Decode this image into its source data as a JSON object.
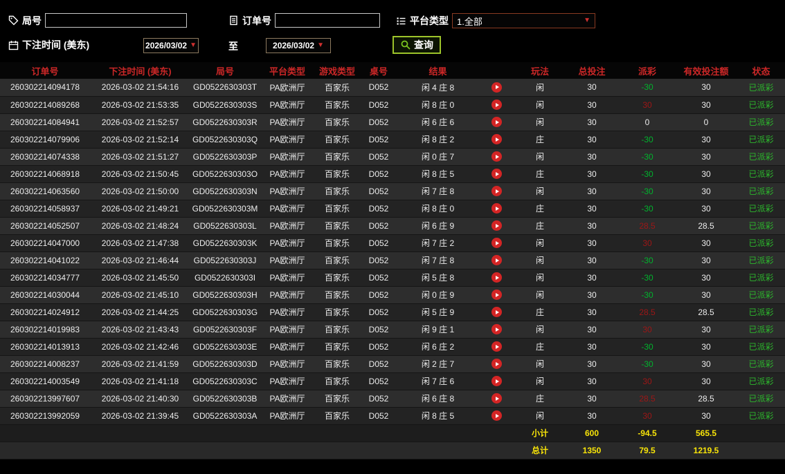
{
  "colors": {
    "header_text": "#cb2727",
    "payout_negative": "#00b32d",
    "payout_positive": "#9e1616",
    "status_paid": "#2db82d",
    "footer_text": "#f8e408",
    "play_icon": "#d42525",
    "query_border": "#9dc42a",
    "arrow_red": "#d03030"
  },
  "filters": {
    "game_no": {
      "label": "局号",
      "value": ""
    },
    "order_no": {
      "label": "订单号",
      "value": ""
    },
    "platform_type": {
      "label": "平台类型",
      "value": "1.全部"
    },
    "bet_time": {
      "label": "下注时间 (美东)",
      "from": "2026/03/02",
      "to_separator": "至",
      "to": "2026/03/02"
    },
    "query_label": "查询"
  },
  "table": {
    "headers": [
      "订单号",
      "下注时间 (美东)",
      "局号",
      "平台类型",
      "游戏类型",
      "桌号",
      "结果",
      "玩法",
      "总投注",
      "派彩",
      "有效投注额",
      "状态"
    ],
    "rows": [
      {
        "order_no": "260302214094178",
        "bet_time": "2026-03-02 21:54:16",
        "game_no": "GD0522630303T",
        "platform": "PA欧洲厅",
        "game_type": "百家乐",
        "table_no": "D052",
        "result": "闲 4 庄 8",
        "bet_side": "闲",
        "total_bet": "30",
        "payout": "-30",
        "valid_bet": "30",
        "status": "已派彩"
      },
      {
        "order_no": "260302214089268",
        "bet_time": "2026-03-02 21:53:35",
        "game_no": "GD0522630303S",
        "platform": "PA欧洲厅",
        "game_type": "百家乐",
        "table_no": "D052",
        "result": "闲 8 庄 0",
        "bet_side": "闲",
        "total_bet": "30",
        "payout": "30",
        "valid_bet": "30",
        "status": "已派彩"
      },
      {
        "order_no": "260302214084941",
        "bet_time": "2026-03-02 21:52:57",
        "game_no": "GD0522630303R",
        "platform": "PA欧洲厅",
        "game_type": "百家乐",
        "table_no": "D052",
        "result": "闲 6 庄 6",
        "bet_side": "闲",
        "total_bet": "30",
        "payout": "0",
        "valid_bet": "0",
        "status": "已派彩"
      },
      {
        "order_no": "260302214079906",
        "bet_time": "2026-03-02 21:52:14",
        "game_no": "GD0522630303Q",
        "platform": "PA欧洲厅",
        "game_type": "百家乐",
        "table_no": "D052",
        "result": "闲 8 庄 2",
        "bet_side": "庄",
        "total_bet": "30",
        "payout": "-30",
        "valid_bet": "30",
        "status": "已派彩"
      },
      {
        "order_no": "260302214074338",
        "bet_time": "2026-03-02 21:51:27",
        "game_no": "GD0522630303P",
        "platform": "PA欧洲厅",
        "game_type": "百家乐",
        "table_no": "D052",
        "result": "闲 0 庄 7",
        "bet_side": "闲",
        "total_bet": "30",
        "payout": "-30",
        "valid_bet": "30",
        "status": "已派彩"
      },
      {
        "order_no": "260302214068918",
        "bet_time": "2026-03-02 21:50:45",
        "game_no": "GD0522630303O",
        "platform": "PA欧洲厅",
        "game_type": "百家乐",
        "table_no": "D052",
        "result": "闲 8 庄 5",
        "bet_side": "庄",
        "total_bet": "30",
        "payout": "-30",
        "valid_bet": "30",
        "status": "已派彩"
      },
      {
        "order_no": "260302214063560",
        "bet_time": "2026-03-02 21:50:00",
        "game_no": "GD0522630303N",
        "platform": "PA欧洲厅",
        "game_type": "百家乐",
        "table_no": "D052",
        "result": "闲 7 庄 8",
        "bet_side": "闲",
        "total_bet": "30",
        "payout": "-30",
        "valid_bet": "30",
        "status": "已派彩"
      },
      {
        "order_no": "260302214058937",
        "bet_time": "2026-03-02 21:49:21",
        "game_no": "GD0522630303M",
        "platform": "PA欧洲厅",
        "game_type": "百家乐",
        "table_no": "D052",
        "result": "闲 8 庄 0",
        "bet_side": "庄",
        "total_bet": "30",
        "payout": "-30",
        "valid_bet": "30",
        "status": "已派彩"
      },
      {
        "order_no": "260302214052507",
        "bet_time": "2026-03-02 21:48:24",
        "game_no": "GD0522630303L",
        "platform": "PA欧洲厅",
        "game_type": "百家乐",
        "table_no": "D052",
        "result": "闲 6 庄 9",
        "bet_side": "庄",
        "total_bet": "30",
        "payout": "28.5",
        "valid_bet": "28.5",
        "status": "已派彩"
      },
      {
        "order_no": "260302214047000",
        "bet_time": "2026-03-02 21:47:38",
        "game_no": "GD0522630303K",
        "platform": "PA欧洲厅",
        "game_type": "百家乐",
        "table_no": "D052",
        "result": "闲 7 庄 2",
        "bet_side": "闲",
        "total_bet": "30",
        "payout": "30",
        "valid_bet": "30",
        "status": "已派彩"
      },
      {
        "order_no": "260302214041022",
        "bet_time": "2026-03-02 21:46:44",
        "game_no": "GD0522630303J",
        "platform": "PA欧洲厅",
        "game_type": "百家乐",
        "table_no": "D052",
        "result": "闲 7 庄 8",
        "bet_side": "闲",
        "total_bet": "30",
        "payout": "-30",
        "valid_bet": "30",
        "status": "已派彩"
      },
      {
        "order_no": "260302214034777",
        "bet_time": "2026-03-02 21:45:50",
        "game_no": "GD0522630303I",
        "platform": "PA欧洲厅",
        "game_type": "百家乐",
        "table_no": "D052",
        "result": "闲 5 庄 8",
        "bet_side": "闲",
        "total_bet": "30",
        "payout": "-30",
        "valid_bet": "30",
        "status": "已派彩"
      },
      {
        "order_no": "260302214030044",
        "bet_time": "2026-03-02 21:45:10",
        "game_no": "GD0522630303H",
        "platform": "PA欧洲厅",
        "game_type": "百家乐",
        "table_no": "D052",
        "result": "闲 0 庄 9",
        "bet_side": "闲",
        "total_bet": "30",
        "payout": "-30",
        "valid_bet": "30",
        "status": "已派彩"
      },
      {
        "order_no": "260302214024912",
        "bet_time": "2026-03-02 21:44:25",
        "game_no": "GD0522630303G",
        "platform": "PA欧洲厅",
        "game_type": "百家乐",
        "table_no": "D052",
        "result": "闲 5 庄 9",
        "bet_side": "庄",
        "total_bet": "30",
        "payout": "28.5",
        "valid_bet": "28.5",
        "status": "已派彩"
      },
      {
        "order_no": "260302214019983",
        "bet_time": "2026-03-02 21:43:43",
        "game_no": "GD0522630303F",
        "platform": "PA欧洲厅",
        "game_type": "百家乐",
        "table_no": "D052",
        "result": "闲 9 庄 1",
        "bet_side": "闲",
        "total_bet": "30",
        "payout": "30",
        "valid_bet": "30",
        "status": "已派彩"
      },
      {
        "order_no": "260302214013913",
        "bet_time": "2026-03-02 21:42:46",
        "game_no": "GD0522630303E",
        "platform": "PA欧洲厅",
        "game_type": "百家乐",
        "table_no": "D052",
        "result": "闲 6 庄 2",
        "bet_side": "庄",
        "total_bet": "30",
        "payout": "-30",
        "valid_bet": "30",
        "status": "已派彩"
      },
      {
        "order_no": "260302214008237",
        "bet_time": "2026-03-02 21:41:59",
        "game_no": "GD0522630303D",
        "platform": "PA欧洲厅",
        "game_type": "百家乐",
        "table_no": "D052",
        "result": "闲 2 庄 7",
        "bet_side": "闲",
        "total_bet": "30",
        "payout": "-30",
        "valid_bet": "30",
        "status": "已派彩"
      },
      {
        "order_no": "260302214003549",
        "bet_time": "2026-03-02 21:41:18",
        "game_no": "GD0522630303C",
        "platform": "PA欧洲厅",
        "game_type": "百家乐",
        "table_no": "D052",
        "result": "闲 7 庄 6",
        "bet_side": "闲",
        "total_bet": "30",
        "payout": "30",
        "valid_bet": "30",
        "status": "已派彩"
      },
      {
        "order_no": "260302213997607",
        "bet_time": "2026-03-02 21:40:30",
        "game_no": "GD0522630303B",
        "platform": "PA欧洲厅",
        "game_type": "百家乐",
        "table_no": "D052",
        "result": "闲 6 庄 8",
        "bet_side": "庄",
        "total_bet": "30",
        "payout": "28.5",
        "valid_bet": "28.5",
        "status": "已派彩"
      },
      {
        "order_no": "260302213992059",
        "bet_time": "2026-03-02 21:39:45",
        "game_no": "GD0522630303A",
        "platform": "PA欧洲厅",
        "game_type": "百家乐",
        "table_no": "D052",
        "result": "闲 8 庄 5",
        "bet_side": "闲",
        "total_bet": "30",
        "payout": "30",
        "valid_bet": "30",
        "status": "已派彩"
      }
    ],
    "subtotal": {
      "label": "小计",
      "total_bet": "600",
      "payout": "-94.5",
      "valid_bet": "565.5"
    },
    "total": {
      "label": "总计",
      "total_bet": "1350",
      "payout": "79.5",
      "valid_bet": "1219.5"
    }
  }
}
